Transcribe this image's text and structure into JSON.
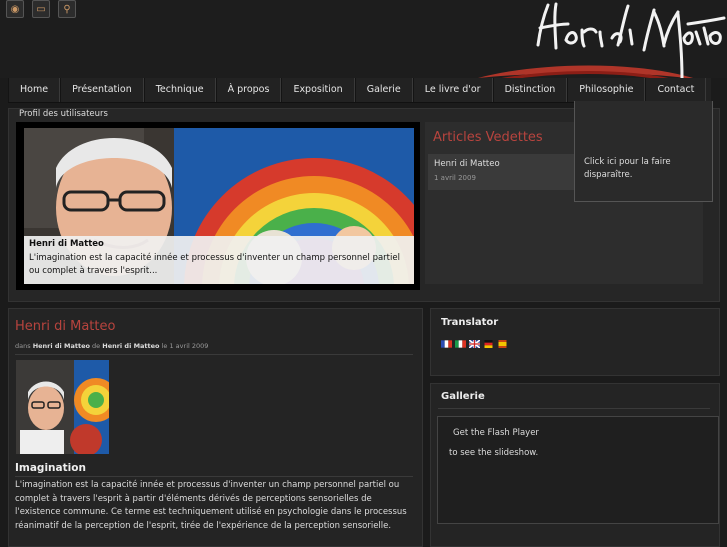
{
  "header": {
    "icons": [
      "rss-icon",
      "folder-icon",
      "search-icon"
    ],
    "logo_text": "Henri di Matteo"
  },
  "nav": {
    "items": [
      {
        "label": "Home"
      },
      {
        "label": "Présentation"
      },
      {
        "label": "Technique"
      },
      {
        "label": "À propos"
      },
      {
        "label": "Exposition"
      },
      {
        "label": "Galerie"
      },
      {
        "label": "Le livre d'or"
      },
      {
        "label": "Distinction"
      },
      {
        "label": "Philosophie"
      },
      {
        "label": "Contact"
      }
    ]
  },
  "popup": {
    "text": "Click ici pour la faire disparaître."
  },
  "featured": {
    "label": "Profil des utilisateurs",
    "caption_title": "Henri di Matteo",
    "caption_text": "L'imagination est la capacité innée et processus d'inventer un champ personnel partiel ou complet à travers l'esprit..."
  },
  "articles": {
    "title": "Articles Vedettes",
    "items": [
      {
        "name": "Henri di Matteo",
        "date": "1 avril 2009"
      }
    ]
  },
  "post": {
    "title": "Henri di Matteo",
    "meta_dans": "dans",
    "meta_cat": "Henri di Matteo",
    "meta_de": "de",
    "meta_author": "Henri di Matteo",
    "meta_le": "le",
    "meta_date": "1 avril 2009",
    "heading": "Imagination",
    "body": "L'imagination est la capacité innée et processus d'inventer un champ personnel partiel ou complet à travers l'esprit à partir d'éléments dérivés de perceptions sensorielles de l'existence commune. Ce terme est techniquement utilisé en psychologie dans le processus réanimatif de la perception de l'esprit, tirée de l'expérience de la perception sensorielle."
  },
  "translator": {
    "title": "Translator",
    "flags": [
      "flag-fr-icon",
      "flag-it-icon",
      "flag-en-icon",
      "flag-de-icon",
      "flag-es-icon"
    ]
  },
  "gallery": {
    "title": "Gallerie",
    "flash_text": "Get the Flash Player",
    "slideshow_text": "to see the slideshow."
  },
  "colors": {
    "accent": "#b8443e",
    "background": "#1b1b1b"
  }
}
